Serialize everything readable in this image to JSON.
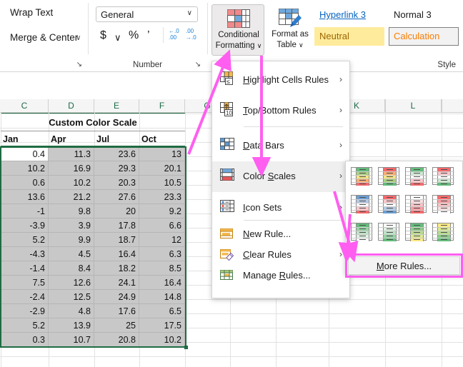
{
  "ribbon": {
    "alignment_group": {
      "wrap_text": "Wrap Text",
      "merge_center": "Merge & Center",
      "caret": "∨"
    },
    "number_group": {
      "label": "Number",
      "format_value": "General",
      "format_caret": "∨",
      "currency": "$",
      "currency_caret": "∨",
      "percent": "%",
      "comma": "\t",
      "increase_decimal": "←.0",
      "increase_decimal_sub": ".00",
      "decrease_decimal": "→.0",
      "decrease_decimal_sub": ".00",
      "dialog_launcher": "↘"
    },
    "alignment_dialog_launcher": "↘",
    "conditional_formatting": {
      "line1": "Conditional",
      "line2": "Formatting",
      "caret": "∨",
      "icon": "conditional-formatting-icon"
    },
    "format_as_table": {
      "line1": "Format as",
      "line2": "Table",
      "caret": "∨",
      "icon": "format-as-table-icon"
    },
    "styles_group": {
      "label": "Style",
      "items": [
        {
          "name": "Hyperlink 3"
        },
        {
          "name": "Normal 3"
        },
        {
          "name": "Neutral"
        },
        {
          "name": "Calculation"
        }
      ]
    }
  },
  "menu": {
    "items": [
      {
        "label": "Highlight Cells Rules",
        "accel": "H",
        "arrow": "›",
        "icon": "highlight-cells-rules-icon",
        "has_submenu": true
      },
      {
        "label": "Top/Bottom Rules",
        "accel": "T",
        "arrow": "›",
        "icon": "top-bottom-rules-icon",
        "has_submenu": true
      },
      {
        "label": "Data Bars",
        "accel": "D",
        "arrow": "›",
        "icon": "data-bars-icon",
        "has_submenu": true
      },
      {
        "label": "Color Scales",
        "accel": "S",
        "arrow": "›",
        "icon": "color-scales-icon",
        "has_submenu": true,
        "highlighted": true
      },
      {
        "label": "Icon Sets",
        "accel": "I",
        "arrow": "›",
        "icon": "icon-sets-icon",
        "has_submenu": true
      },
      {
        "label": "New Rule...",
        "accel": "N",
        "arrow": "",
        "icon": "new-rule-icon",
        "has_submenu": false
      },
      {
        "label": "Clear Rules",
        "accel": "C",
        "arrow": "›",
        "icon": "clear-rules-icon",
        "has_submenu": true
      },
      {
        "label": "Manage Rules...",
        "accel": "R",
        "arrow": "",
        "icon": "manage-rules-icon",
        "has_submenu": false
      }
    ]
  },
  "submenu": {
    "title": "color-scales-gallery",
    "more_rules": "More Rules...",
    "more_rules_accel": "M",
    "swatches": [
      {
        "name": "green-yellow-red",
        "colors": [
          "#63be7b",
          "#a9d07f",
          "#f5e583",
          "#fbae6f",
          "#f8696b"
        ]
      },
      {
        "name": "red-yellow-green",
        "colors": [
          "#f8696b",
          "#fbae6f",
          "#f5e583",
          "#a9d07f",
          "#63be7b"
        ]
      },
      {
        "name": "green-white-red",
        "colors": [
          "#63be7b",
          "#cfe9d3",
          "#ffffff",
          "#fbc7cb",
          "#f8696b"
        ]
      },
      {
        "name": "red-white-green",
        "colors": [
          "#f8696b",
          "#fbc7cb",
          "#ffffff",
          "#cfe9d3",
          "#63be7b"
        ]
      },
      {
        "name": "blue-white-red",
        "colors": [
          "#6c9fd4",
          "#b3c9e4",
          "#ffffff",
          "#fbc7cb",
          "#f8696b"
        ]
      },
      {
        "name": "red-white-blue",
        "colors": [
          "#f8696b",
          "#fbc7cb",
          "#ffffff",
          "#b3c9e4",
          "#6c9fd4"
        ]
      },
      {
        "name": "white-red",
        "colors": [
          "#ffffff",
          "#fbdfe1",
          "#f9c3c6",
          "#fa9da1",
          "#f8696b"
        ]
      },
      {
        "name": "red-white",
        "colors": [
          "#f8696b",
          "#fa9da1",
          "#f9c3c6",
          "#fbdfe1",
          "#ffffff"
        ]
      },
      {
        "name": "green-white",
        "colors": [
          "#63be7b",
          "#96d3a3",
          "#bee3c6",
          "#dff1e3",
          "#ffffff"
        ]
      },
      {
        "name": "white-green",
        "colors": [
          "#ffffff",
          "#dff1e3",
          "#bee3c6",
          "#96d3a3",
          "#63be7b"
        ]
      },
      {
        "name": "green-yellow",
        "colors": [
          "#63be7b",
          "#8fcd88",
          "#b9dc8e",
          "#dceb93",
          "#ffeb84"
        ]
      },
      {
        "name": "yellow-green",
        "colors": [
          "#ffeb84",
          "#dceb93",
          "#b9dc8e",
          "#8fcd88",
          "#63be7b"
        ]
      }
    ]
  },
  "sheet": {
    "columns": [
      "C",
      "D",
      "E",
      "F",
      "G",
      "K",
      "L"
    ],
    "title": "Custom Color Scale",
    "headers": [
      "Jan",
      "Apr",
      "Jul",
      "Oct"
    ],
    "rows": [
      [
        "0.4",
        "11.3",
        "23.6",
        "13"
      ],
      [
        "10.2",
        "16.9",
        "29.3",
        "20.1"
      ],
      [
        "0.6",
        "10.2",
        "20.3",
        "10.5"
      ],
      [
        "13.6",
        "21.2",
        "27.6",
        "23.3"
      ],
      [
        "-1",
        "9.8",
        "20",
        "9.2"
      ],
      [
        "-3.9",
        "3.9",
        "17.8",
        "6.6"
      ],
      [
        "5.2",
        "9.9",
        "18.7",
        "12"
      ],
      [
        "-4.3",
        "4.5",
        "16.4",
        "6.3"
      ],
      [
        "-1.4",
        "8.4",
        "18.2",
        "8.5"
      ],
      [
        "7.5",
        "12.6",
        "24.1",
        "16.4"
      ],
      [
        "-2.4",
        "12.5",
        "24.9",
        "14.8"
      ],
      [
        "-2.9",
        "4.8",
        "17.6",
        "6.5"
      ],
      [
        "5.2",
        "13.9",
        "25",
        "17.5"
      ],
      [
        "0.3",
        "10.7",
        "20.8",
        "10.2"
      ]
    ]
  },
  "annotations": {
    "arrow_color": "#ff5ef0",
    "highlight_color": "#ff5ef0"
  }
}
